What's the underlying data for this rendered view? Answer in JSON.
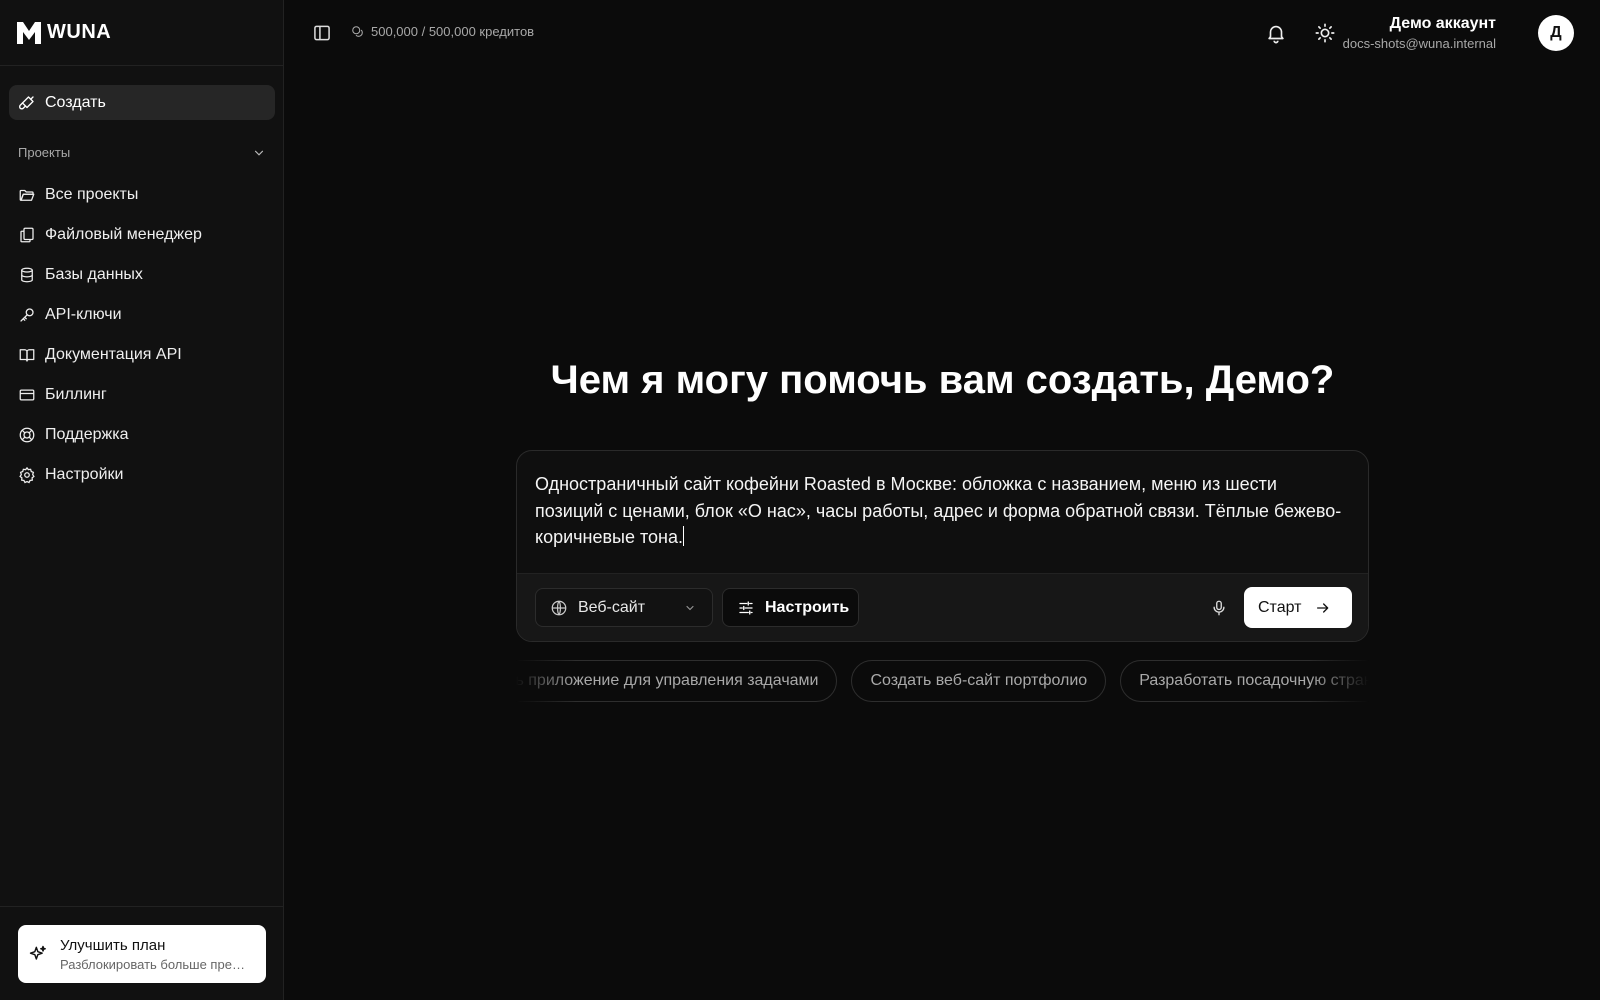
{
  "brand": {
    "name": "WUNA"
  },
  "sidebar": {
    "create_label": "Создать",
    "section_title": "Проекты",
    "items": [
      {
        "label": "Все проекты",
        "icon": "folder-open-icon"
      },
      {
        "label": "Файловый менеджер",
        "icon": "files-icon"
      },
      {
        "label": "Базы данных",
        "icon": "database-icon"
      },
      {
        "label": "API-ключи",
        "icon": "key-icon"
      },
      {
        "label": "Документация API",
        "icon": "book-open-icon"
      },
      {
        "label": "Биллинг",
        "icon": "credit-card-icon"
      },
      {
        "label": "Поддержка",
        "icon": "life-buoy-icon"
      },
      {
        "label": "Настройки",
        "icon": "gear-icon"
      }
    ],
    "upgrade": {
      "title": "Улучшить план",
      "subtitle": "Разблокировать больше преимуществ"
    }
  },
  "header": {
    "credits": "500,000 / 500,000 кредитов",
    "account_name": "Демо аккаунт",
    "account_email": "docs-shots@wuna.internal",
    "avatar_initial": "Д"
  },
  "main": {
    "headline": "Чем я могу помочь вам создать, Демо?",
    "prompt": "Одностраничный сайт кофейни Roasted в Москве: обложка с названием, меню из шести позиций с ценами, блок «О нас», часы работы, адрес и форма обратной связи. Тёплые бежево-коричневые тона.",
    "type_select": "Веб-сайт",
    "configure_label": "Настроить",
    "start_label": "Старт",
    "suggestions": [
      "Создать приложение для управления задачами",
      "Создать веб-сайт портфолио",
      "Разработать посадочную страницу"
    ]
  }
}
